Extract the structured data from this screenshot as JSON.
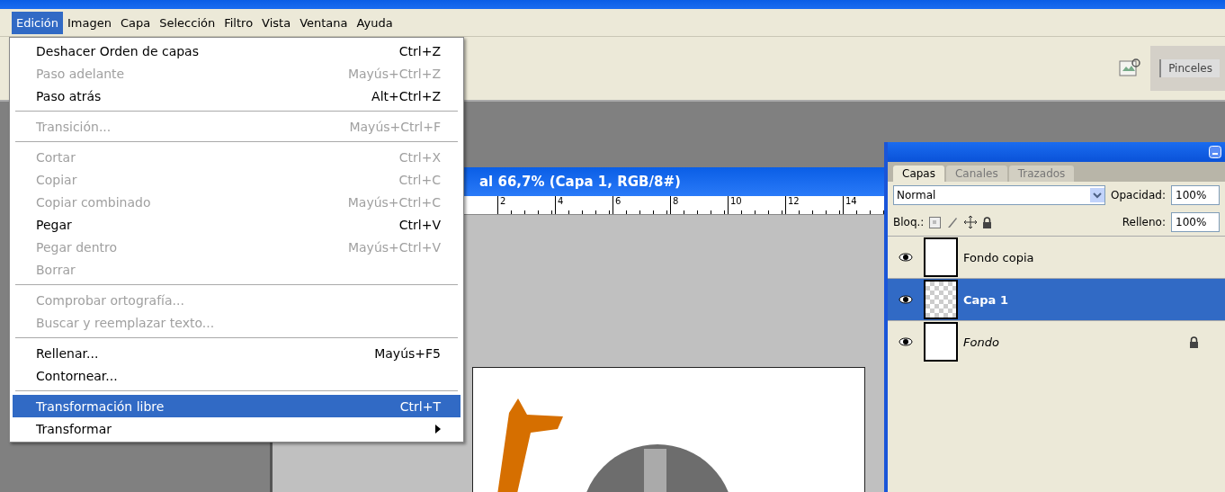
{
  "menu_bar": [
    {
      "label": "Edición",
      "selected": true
    },
    {
      "label": "Imagen",
      "selected": false
    },
    {
      "label": "Capa",
      "selected": false
    },
    {
      "label": "Selección",
      "selected": false
    },
    {
      "label": "Filtro",
      "selected": false
    },
    {
      "label": "Vista",
      "selected": false
    },
    {
      "label": "Ventana",
      "selected": false
    },
    {
      "label": "Ayuda",
      "selected": false
    }
  ],
  "edit_menu": [
    {
      "kind": "item",
      "label": "Deshacer Orden de capas",
      "shortcut": "Ctrl+Z",
      "disabled": false,
      "selected": false
    },
    {
      "kind": "item",
      "label": "Paso adelante",
      "shortcut": "Mayús+Ctrl+Z",
      "disabled": true,
      "selected": false
    },
    {
      "kind": "item",
      "label": "Paso atrás",
      "shortcut": "Alt+Ctrl+Z",
      "disabled": false,
      "selected": false
    },
    {
      "kind": "separator"
    },
    {
      "kind": "item",
      "label": "Transición...",
      "shortcut": "Mayús+Ctrl+F",
      "disabled": true,
      "selected": false
    },
    {
      "kind": "separator"
    },
    {
      "kind": "item",
      "label": "Cortar",
      "shortcut": "Ctrl+X",
      "disabled": true,
      "selected": false
    },
    {
      "kind": "item",
      "label": "Copiar",
      "shortcut": "Ctrl+C",
      "disabled": true,
      "selected": false
    },
    {
      "kind": "item",
      "label": "Copiar combinado",
      "shortcut": "Mayús+Ctrl+C",
      "disabled": true,
      "selected": false
    },
    {
      "kind": "item",
      "label": "Pegar",
      "shortcut": "Ctrl+V",
      "disabled": false,
      "selected": false
    },
    {
      "kind": "item",
      "label": "Pegar dentro",
      "shortcut": "Mayús+Ctrl+V",
      "disabled": true,
      "selected": false
    },
    {
      "kind": "item",
      "label": "Borrar",
      "disabled": true,
      "selected": false
    },
    {
      "kind": "separator"
    },
    {
      "kind": "item",
      "label": "Comprobar ortografía...",
      "disabled": true,
      "selected": false
    },
    {
      "kind": "item",
      "label": "Buscar y reemplazar texto...",
      "disabled": true,
      "selected": false
    },
    {
      "kind": "separator"
    },
    {
      "kind": "item",
      "label": "Rellenar...",
      "shortcut": "Mayús+F5",
      "disabled": false,
      "selected": false
    },
    {
      "kind": "item",
      "label": "Contornear...",
      "disabled": false,
      "selected": false
    },
    {
      "kind": "separator"
    },
    {
      "kind": "item",
      "label": "Transformación libre",
      "shortcut": "Ctrl+T",
      "disabled": false,
      "selected": true
    },
    {
      "kind": "submenu",
      "label": "Transformar",
      "disabled": false,
      "selected": false
    }
  ],
  "options_bar": {
    "palette_tab": "Pinceles"
  },
  "document": {
    "title": "al 66,7% (Capa 1, RGB/8#)",
    "ruler_labels": [
      "2",
      "4",
      "6",
      "8",
      "10",
      "12",
      "14"
    ]
  },
  "layers_panel": {
    "tabs": [
      {
        "label": "Capas",
        "selected": true
      },
      {
        "label": "Canales",
        "selected": false
      },
      {
        "label": "Trazados",
        "selected": false
      }
    ],
    "blend_mode": "Normal",
    "opacity_label": "Opacidad:",
    "opacity": "100%",
    "lock_label": "Bloq.:",
    "fill_label": "Relleno:",
    "fill": "100%",
    "layers": [
      {
        "name": "Fondo copia",
        "kind": "normal",
        "visible": true,
        "selected": false,
        "locked": false
      },
      {
        "name": "Capa 1",
        "kind": "normal",
        "visible": true,
        "selected": true,
        "locked": false
      },
      {
        "name": "Fondo",
        "kind": "background",
        "visible": true,
        "selected": false,
        "locked": true
      }
    ]
  }
}
